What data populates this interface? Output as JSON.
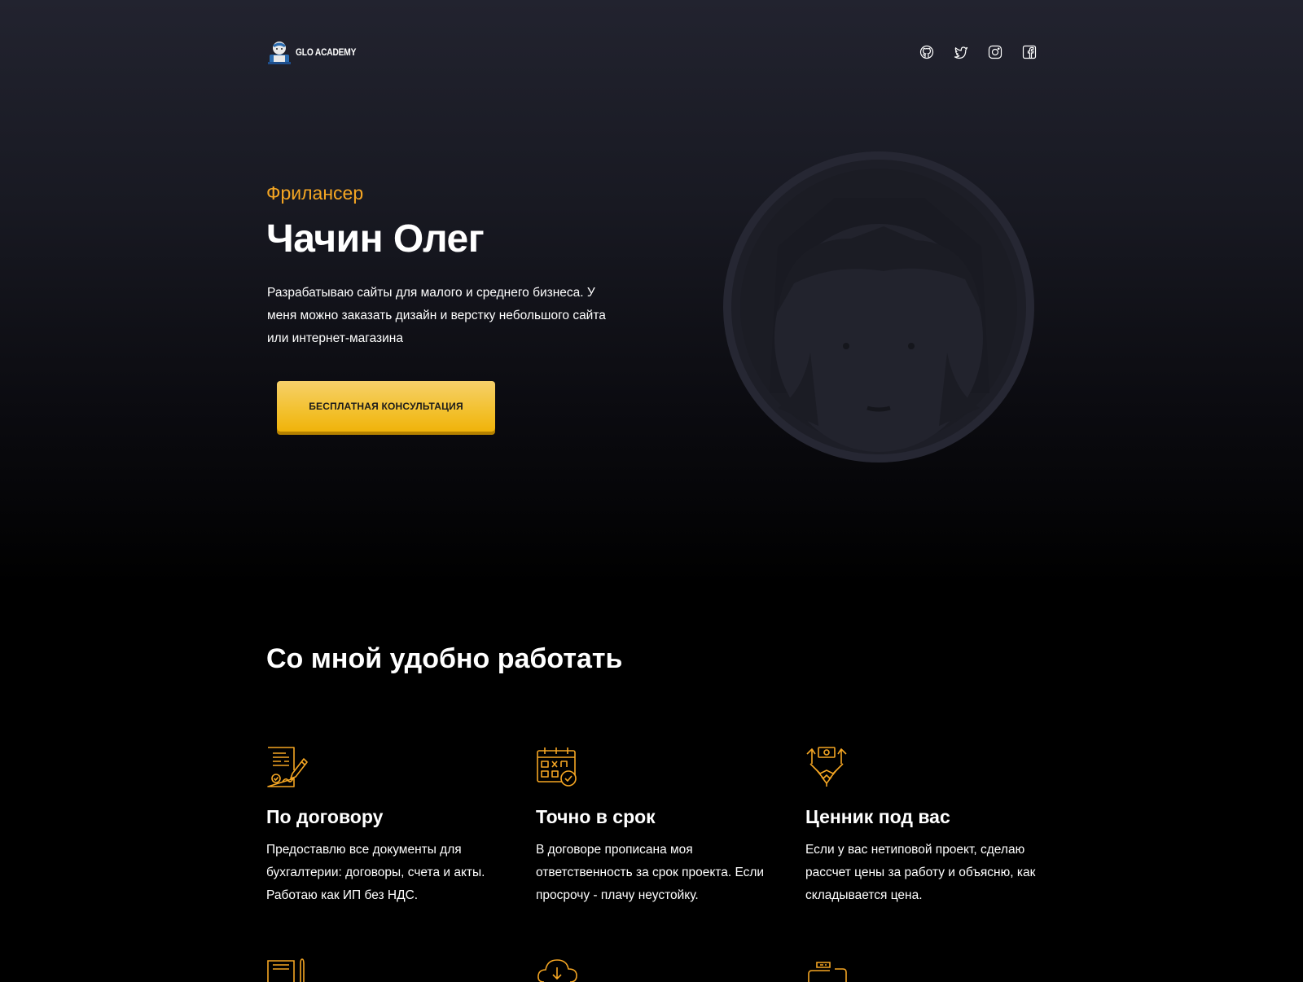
{
  "header": {
    "logo_text": "GLO ACADEMY",
    "socials": [
      {
        "icon": "github-icon"
      },
      {
        "icon": "twitter-icon"
      },
      {
        "icon": "instagram-icon"
      },
      {
        "icon": "facebook-icon"
      }
    ]
  },
  "hero": {
    "subtitle": "Фрилансер",
    "title": "Чачин Олег",
    "description": "Разрабатываю сайты для малого и среднего бизнеса. У меня можно заказать дизайн и верстку небольшого сайта или интернет-магазина",
    "cta_label": "БЕСПЛАТНАЯ КОНСУЛЬТАЦИЯ"
  },
  "features": {
    "title": "Со мной удобно работать",
    "items": [
      {
        "icon": "contract-icon",
        "title": "По договору",
        "text": "Предоставлю все документы для бухгалтерии: договоры, счета и акты. Работаю как ИП без НДС."
      },
      {
        "icon": "calendar-icon",
        "title": "Точно в срок",
        "text": "В договоре прописана моя ответственность за срок проекта. Если просрочу - плачу неустойку."
      },
      {
        "icon": "handshake-icon",
        "title": "Ценник под вас",
        "text": "Если у вас нетиповой проект, сделаю рассчет цены за работу и объясню, как складывается цена."
      }
    ]
  },
  "colors": {
    "accent": "#f5a623",
    "button": "#f3c232",
    "background": "#000000"
  }
}
